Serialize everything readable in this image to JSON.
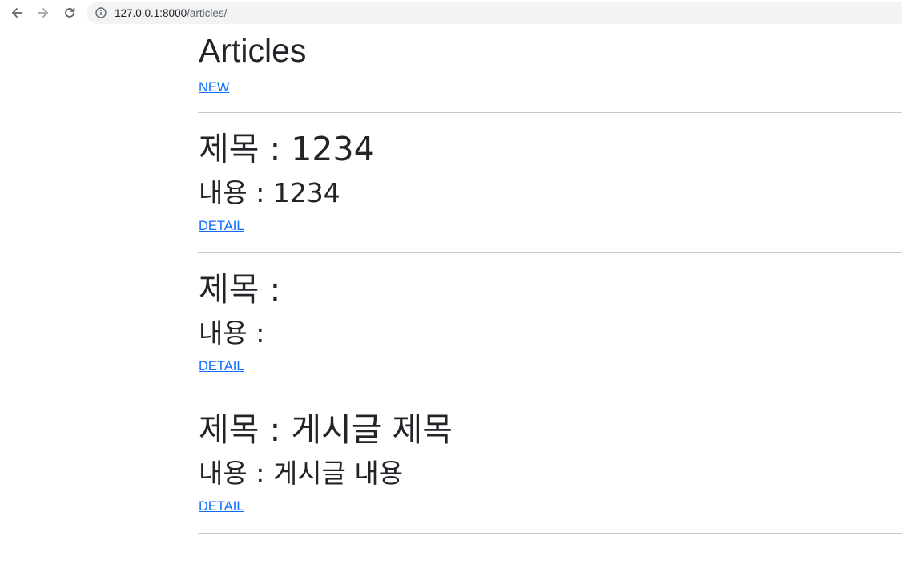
{
  "browser": {
    "url_host": "127.0.0.1:8000",
    "url_path": "/articles/",
    "back_icon": "arrow-left-icon",
    "forward_icon": "arrow-right-icon",
    "reload_icon": "reload-icon",
    "info_icon": "info-icon"
  },
  "page": {
    "title": "Articles",
    "new_link": "NEW"
  },
  "articles": [
    {
      "title": "제목 : 1234",
      "content": "내용 : 1234",
      "detail_link": "DETAIL"
    },
    {
      "title": "제목 :",
      "content": "내용 :",
      "detail_link": "DETAIL"
    },
    {
      "title": "제목 : 게시글 제목",
      "content": "내용 : 게시글 내용",
      "detail_link": "DETAIL"
    }
  ],
  "colors": {
    "link": "#0d6efd",
    "text": "#212529",
    "rule": "#c8c8c8"
  }
}
